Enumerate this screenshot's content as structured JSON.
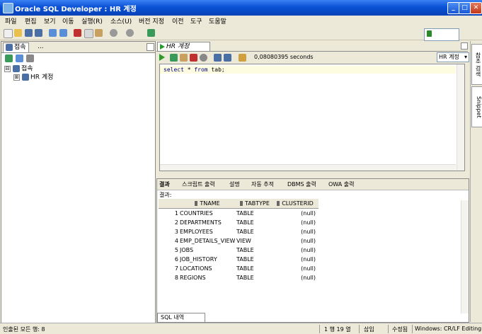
{
  "window": {
    "title": "Oracle SQL Developer : HR 계정",
    "min_label": "_",
    "max_label": "□",
    "close_label": "✕"
  },
  "menu": [
    "파일",
    "편집",
    "보기",
    "이동",
    "실행(R)",
    "소스(U)",
    "버전 지정",
    "이전",
    "도구",
    "도움말"
  ],
  "left_panel": {
    "tabs": [
      "접속",
      "..."
    ],
    "tree": [
      {
        "expander": "⊟",
        "label": "접속"
      },
      {
        "expander": "⊞",
        "label": "HR 계정"
      }
    ]
  },
  "editor": {
    "tab_label": "HR 계정",
    "elapsed": "0,08080395 seconds",
    "connection": "HR 계정",
    "code": {
      "kw1": "select",
      "rest1": " * ",
      "kw2": "from",
      "rest2": " tab;"
    }
  },
  "results": {
    "tabs": [
      "결과",
      "스크립트 출력",
      "설명",
      "자동 추적",
      "DBMS 출력",
      "OWA 출력"
    ],
    "label": "결과:",
    "columns": [
      "",
      "TNAME",
      "TABTYPE",
      "CLUSTERID"
    ],
    "rows": [
      [
        "1",
        "COUNTRIES",
        "TABLE",
        "(null)"
      ],
      [
        "2",
        "DEPARTMENTS",
        "TABLE",
        "(null)"
      ],
      [
        "3",
        "EMPLOYEES",
        "TABLE",
        "(null)"
      ],
      [
        "4",
        "EMP_DETAILS_VIEW",
        "VIEW",
        "(null)"
      ],
      [
        "5",
        "JOBS",
        "TABLE",
        "(null)"
      ],
      [
        "6",
        "JOB_HISTORY",
        "TABLE",
        "(null)"
      ],
      [
        "7",
        "LOCATIONS",
        "TABLE",
        "(null)"
      ],
      [
        "8",
        "REGIONS",
        "TABLE",
        "(null)"
      ]
    ],
    "bottom_tab": "SQL 내역"
  },
  "right_strip": {
    "tabs": [
      "참조 검색",
      "Snippet"
    ]
  },
  "status": {
    "left": "인출된 모든 행: 8",
    "position": "1 행 19 열",
    "mode": "삽입",
    "modified": "수정됨",
    "eol": "Windows: CR/LF Editing"
  },
  "colors": {
    "title_blue": "#0a52d6",
    "run_green": "#2a9a2a",
    "keyword": "#000080",
    "current_line": "#fdfbe0"
  }
}
